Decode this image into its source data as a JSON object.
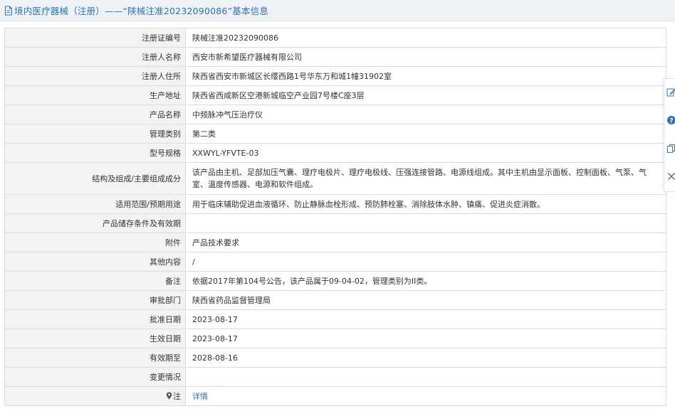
{
  "page": {
    "title": "境内医疗器械（注册）——“陕械注准20232090086”基本信息"
  },
  "rows": [
    {
      "label": "注册证编号",
      "value": "陕械注准20232090086"
    },
    {
      "label": "注册人名称",
      "value": "西安市新希望医疗器械有限公司"
    },
    {
      "label": "注册人住所",
      "value": "陕西省西安市新城区长缨西路1号华东万和城1幢31902室"
    },
    {
      "label": "生产地址",
      "value": "陕西省西咸新区空港新城临空产业园7号楼C座3层"
    },
    {
      "label": "产品名称",
      "value": "中频脉冲气压治疗仪"
    },
    {
      "label": "管理类别",
      "value": "第二类"
    },
    {
      "label": "型号规格",
      "value": "XXWYL-YFVTE-03"
    },
    {
      "label": "结构及组成/主要组成成分",
      "value": "该产品由主机、足部加压气囊、理疗电极片、理疗电极线、压强连接管路、电源线组成。其中主机由显示面板、控制面板、气泵、气室、温度传感器、电源和软件组成。"
    },
    {
      "label": "适用范围/预期用途",
      "value": "用于临床辅助促进血液循环、防止静脉血栓形成、预防肺栓塞、消除肢体水肿、镇痛、促进炎症消散。"
    },
    {
      "label": "产品储存条件及有效期",
      "value": ""
    },
    {
      "label": "附件",
      "value": "产品技术要求"
    },
    {
      "label": "其他内容",
      "value": "/"
    },
    {
      "label": "备注",
      "value": "依据2017年第104号公告，该产品属于09-04-02，管理类别为II类。"
    },
    {
      "label": "审批部门",
      "value": "陕西省药品监督管理局"
    },
    {
      "label": "批准日期",
      "value": "2023-08-17"
    },
    {
      "label": "生效日期",
      "value": "2023-08-17"
    },
    {
      "label": "有效期至",
      "value": "2028-08-16"
    },
    {
      "label": "变更情况",
      "value": ""
    }
  ],
  "note_row": {
    "label": "注",
    "link_text": "详情",
    "icon": "map-pin-icon"
  },
  "side_toolbar": {
    "icons": [
      "edit-icon",
      "help-icon",
      "copy-icon",
      "close-icon"
    ]
  },
  "colors": {
    "title_blue": "#2d72b8",
    "label_bg": "#f3f3f3",
    "border": "#dcdcdc",
    "title_bar_bg": "#eef2f5"
  }
}
